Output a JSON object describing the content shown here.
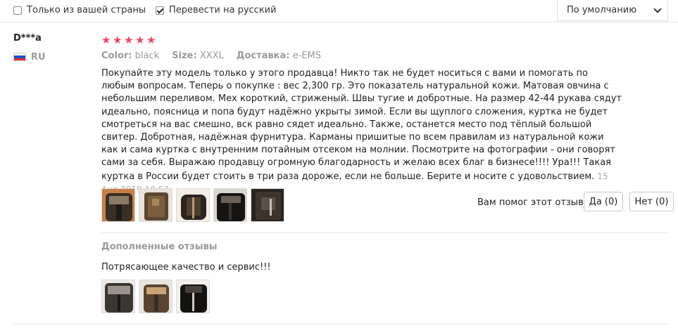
{
  "filters": {
    "own_country": {
      "label": "Только из вашей страны",
      "checked": false
    },
    "translate": {
      "label": "Перевести на русский",
      "checked": true
    }
  },
  "sort": {
    "selected": "По умолчанию"
  },
  "review": {
    "user": "D***a",
    "country": "RU",
    "rating": 5,
    "meta": {
      "color_label": "Color:",
      "color_value": "black",
      "size_label": "Size:",
      "size_value": "XXXL",
      "delivery_label": "Доставка:",
      "delivery_value": "e-EMS"
    },
    "text": "Покупайте эту модель только у этого продавца! Никто так не будет носиться с вами и помогать по любым вопросам. Теперь о покупке : вес 2,300 гр. Это показатель натуральной кожи. Матовая овчина с небольшим переливом. Мех короткий, стриженый. Швы тугие и добротные. На размер 42-44 рукава сядут идеально, поясница и попа будут надёжно укрыты зимой. Если вы щуплого сложения, куртка не будет смотреться на вас смешно, вск равно сядет идеально. Также, останется место под тёплый большой свитер. Добротная, надёжная фурнитура. Карманы пришитые по всем правилам из натуральной кожи как и сама куртка с внутренним потайным отсеком на молнии. Посмотрите на фотографии - они говорят сами за себя. Выражаю продавцу огромную благодарность и желаю всех благ в бизнесе!!!! Ура!!! Такая куртка в России будет стоить в три раза дороже, если не больше. Берите и носите с удовольствием.",
    "date": "15 Aug 2019 10:53",
    "helpful_question": "Вам помог этот отзыв?",
    "yes_label": "Да (0)",
    "no_label": "Нет (0)",
    "additional": {
      "title": "Дополненные отзывы",
      "text": "Потрясающее качество и сервис!!!"
    }
  },
  "colors": {
    "star": "#f5415b",
    "flag_white": "#ffffff",
    "flag_blue": "#1f4fd1",
    "flag_red": "#e02b2b"
  }
}
